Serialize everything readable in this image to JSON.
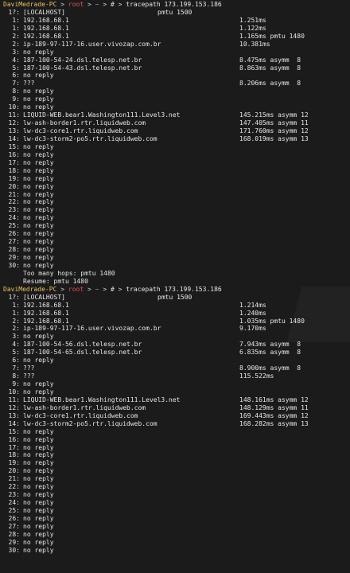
{
  "prompt": {
    "host": "DaviMedrade-PC",
    "arrow1": ">",
    "user": "root",
    "arrow2": ">",
    "tilde": "~",
    "arrow3": ">",
    "hash": "#",
    "arrow4": ">"
  },
  "runs": [
    {
      "command": "tracepath 173.199.153.186",
      "hops": [
        {
          "n": "1?:",
          "name": "[LOCALHOST]",
          "time": "pmtu 1500",
          "head": true
        },
        {
          "n": "1:",
          "name": "192.168.68.1",
          "time": "1.251ms"
        },
        {
          "n": "1:",
          "name": "192.168.68.1",
          "time": "1.122ms"
        },
        {
          "n": "2:",
          "name": "192.168.68.1",
          "time": "1.165ms pmtu 1480"
        },
        {
          "n": "2:",
          "name": "ip-189-97-117-16.user.vivozap.com.br",
          "time": "10.381ms"
        },
        {
          "n": "3:",
          "name": "no reply",
          "time": ""
        },
        {
          "n": "4:",
          "name": "187-100-54-24.dsl.telesp.net.br",
          "time": "8.475ms asymm  8"
        },
        {
          "n": "5:",
          "name": "187-100-54-43.dsl.telesp.net.br",
          "time": "8.863ms asymm  8"
        },
        {
          "n": "6:",
          "name": "no reply",
          "time": ""
        },
        {
          "n": "7:",
          "name": "???",
          "time": "8.206ms asymm  8"
        },
        {
          "n": "8:",
          "name": "no reply",
          "time": ""
        },
        {
          "n": "9:",
          "name": "no reply",
          "time": ""
        },
        {
          "n": "10:",
          "name": "no reply",
          "time": ""
        },
        {
          "n": "11:",
          "name": "LIQUID-WEB.bear1.Washington111.Level3.net",
          "time": "145.215ms asymm 12"
        },
        {
          "n": "12:",
          "name": "lw-ash-border1.rtr.liquidweb.com",
          "time": "147.405ms asymm 11"
        },
        {
          "n": "13:",
          "name": "lw-dc3-core1.rtr.liquidweb.com",
          "time": "171.760ms asymm 12"
        },
        {
          "n": "14:",
          "name": "lw-dc3-storm2-po5.rtr.liquidweb.com",
          "time": "168.019ms asymm 13"
        },
        {
          "n": "15:",
          "name": "no reply",
          "time": ""
        },
        {
          "n": "16:",
          "name": "no reply",
          "time": ""
        },
        {
          "n": "17:",
          "name": "no reply",
          "time": ""
        },
        {
          "n": "18:",
          "name": "no reply",
          "time": ""
        },
        {
          "n": "19:",
          "name": "no reply",
          "time": ""
        },
        {
          "n": "20:",
          "name": "no reply",
          "time": ""
        },
        {
          "n": "21:",
          "name": "no reply",
          "time": ""
        },
        {
          "n": "22:",
          "name": "no reply",
          "time": ""
        },
        {
          "n": "23:",
          "name": "no reply",
          "time": ""
        },
        {
          "n": "24:",
          "name": "no reply",
          "time": ""
        },
        {
          "n": "25:",
          "name": "no reply",
          "time": ""
        },
        {
          "n": "26:",
          "name": "no reply",
          "time": ""
        },
        {
          "n": "27:",
          "name": "no reply",
          "time": ""
        },
        {
          "n": "28:",
          "name": "no reply",
          "time": ""
        },
        {
          "n": "29:",
          "name": "no reply",
          "time": ""
        },
        {
          "n": "30:",
          "name": "no reply",
          "time": ""
        }
      ],
      "summary": [
        "Too many hops: pmtu 1480",
        "Resume: pmtu 1480"
      ]
    },
    {
      "command": "tracepath 173.199.153.186",
      "hops": [
        {
          "n": "1?:",
          "name": "[LOCALHOST]",
          "time": "pmtu 1500",
          "head": true
        },
        {
          "n": "1:",
          "name": "192.168.68.1",
          "time": "1.214ms"
        },
        {
          "n": "1:",
          "name": "192.168.68.1",
          "time": "1.240ms"
        },
        {
          "n": "2:",
          "name": "192.168.68.1",
          "time": "1.035ms pmtu 1480"
        },
        {
          "n": "2:",
          "name": "ip-189-97-117-16.user.vivozap.com.br",
          "time": "9.170ms"
        },
        {
          "n": "3:",
          "name": "no reply",
          "time": ""
        },
        {
          "n": "4:",
          "name": "187-100-54-56.dsl.telesp.net.br",
          "time": "7.943ms asymm  8"
        },
        {
          "n": "5:",
          "name": "187-100-54-65.dsl.telesp.net.br",
          "time": "6.835ms asymm  8"
        },
        {
          "n": "6:",
          "name": "no reply",
          "time": ""
        },
        {
          "n": "7:",
          "name": "???",
          "time": "8.900ms asymm  8"
        },
        {
          "n": "8:",
          "name": "???",
          "time": "115.522ms"
        },
        {
          "n": "9:",
          "name": "no reply",
          "time": ""
        },
        {
          "n": "10:",
          "name": "no reply",
          "time": ""
        },
        {
          "n": "11:",
          "name": "LIQUID-WEB.bear1.Washington111.Level3.net",
          "time": "148.161ms asymm 12"
        },
        {
          "n": "12:",
          "name": "lw-ash-border1.rtr.liquidweb.com",
          "time": "148.129ms asymm 11"
        },
        {
          "n": "13:",
          "name": "lw-dc3-core1.rtr.liquidweb.com",
          "time": "169.443ms asymm 12"
        },
        {
          "n": "14:",
          "name": "lw-dc3-storm2-po5.rtr.liquidweb.com",
          "time": "168.282ms asymm 13"
        },
        {
          "n": "15:",
          "name": "no reply",
          "time": ""
        },
        {
          "n": "16:",
          "name": "no reply",
          "time": ""
        },
        {
          "n": "17:",
          "name": "no reply",
          "time": ""
        },
        {
          "n": "18:",
          "name": "no reply",
          "time": ""
        },
        {
          "n": "19:",
          "name": "no reply",
          "time": ""
        },
        {
          "n": "20:",
          "name": "no reply",
          "time": ""
        },
        {
          "n": "21:",
          "name": "no reply",
          "time": ""
        },
        {
          "n": "22:",
          "name": "no reply",
          "time": ""
        },
        {
          "n": "23:",
          "name": "no reply",
          "time": ""
        },
        {
          "n": "24:",
          "name": "no reply",
          "time": ""
        },
        {
          "n": "25:",
          "name": "no reply",
          "time": ""
        },
        {
          "n": "26:",
          "name": "no reply",
          "time": ""
        },
        {
          "n": "27:",
          "name": "no reply",
          "time": ""
        },
        {
          "n": "28:",
          "name": "no reply",
          "time": ""
        },
        {
          "n": "29:",
          "name": "no reply",
          "time": ""
        },
        {
          "n": "30:",
          "name": "no reply",
          "time": ""
        }
      ],
      "summary": []
    }
  ]
}
